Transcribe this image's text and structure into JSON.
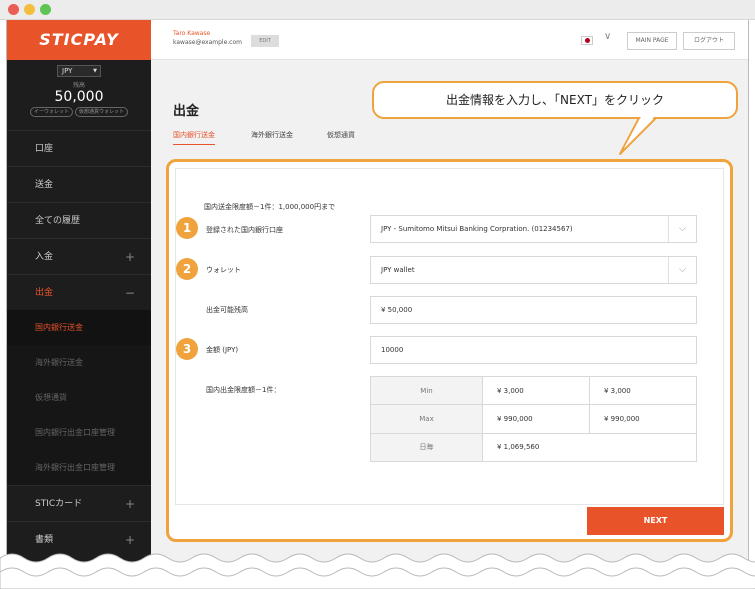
{
  "app": {
    "logo": "STICPAY"
  },
  "sidebar": {
    "currency": "JPY",
    "balance_label": "残高",
    "balance_value": "50,000",
    "wallet_tags": [
      "イーウォレット",
      "仮想通貨ウォレット"
    ],
    "items": [
      {
        "label": "口座"
      },
      {
        "label": "送金"
      },
      {
        "label": "全ての履歴"
      },
      {
        "label": "入金",
        "expand": "+"
      },
      {
        "label": "出金",
        "expand": "−"
      }
    ],
    "sub_items": [
      {
        "label": "国内銀行送金"
      },
      {
        "label": "海外銀行送金"
      },
      {
        "label": "仮想通貨"
      },
      {
        "label": "国内銀行出金口座管理"
      },
      {
        "label": "海外銀行出金口座管理"
      }
    ],
    "bottom_items": [
      {
        "label": "STICカード",
        "expand": "+"
      },
      {
        "label": "書類",
        "expand": "+"
      }
    ]
  },
  "header": {
    "user_name": "Taro Kawase",
    "user_email": "kawase@example.com",
    "edit_label": "EDIT",
    "main_page_label": "MAIN PAGE",
    "logout_label": "ログアウト"
  },
  "page": {
    "title": "出金",
    "tabs": [
      "国内銀行送金",
      "海外銀行送金",
      "仮想通貨"
    ]
  },
  "callout": {
    "text": "出金情報を入力し、「NEXT」をクリック"
  },
  "form": {
    "limit_note": "国内送金限度額－1件：1,000,000円まで",
    "bank_label": "登録された国内銀行口座",
    "bank_value": "JPY - Sumitomo Mitsui Banking Corpration. (01234567)",
    "wallet_label": "ウォレット",
    "wallet_value": "JPY wallet",
    "available_label": "出金可能残高",
    "available_value": "¥ 50,000",
    "amount_label": "金額 (JPY)",
    "amount_value": "10000",
    "limits_label": "国内出金限度額－1件：",
    "limits": [
      {
        "label": "Min",
        "v1": "¥ 3,000",
        "v2": "¥ 3,000"
      },
      {
        "label": "Max",
        "v1": "¥ 990,000",
        "v2": "¥ 990,000"
      },
      {
        "label": "日毎",
        "v1": "¥ 1,069,560",
        "v2": ""
      }
    ],
    "badges": [
      "1",
      "2",
      "3"
    ],
    "next_label": "NEXT"
  },
  "colors": {
    "accent": "#e8532a",
    "callout_border": "#f0a23c",
    "sidebar_bg": "#1d1d1d"
  }
}
